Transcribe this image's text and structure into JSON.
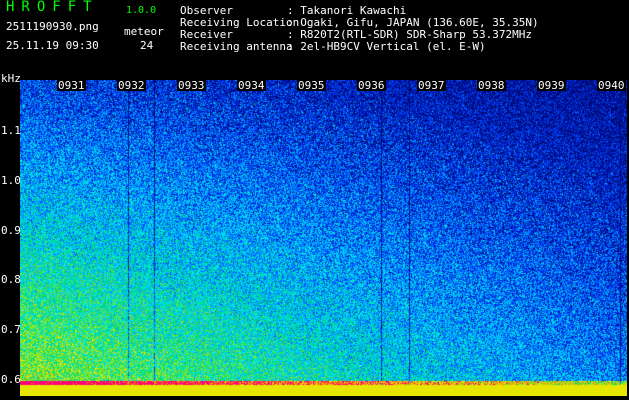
{
  "app": {
    "title": "HROFFT",
    "version": "1.0.0"
  },
  "file_name": "2511190930.png",
  "date_time": "25.11.19 09:30",
  "meteor": {
    "label": "meteor",
    "count": "24"
  },
  "info": [
    {
      "key": "Observer",
      "value": ": Takanori Kawachi"
    },
    {
      "key": "Receiving Location",
      "value": ": Ogaki, Gifu, JAPAN (136.60E, 35.35N)"
    },
    {
      "key": "Receiver",
      "value": ": R820T2(RTL-SDR) SDR-Sharp 53.372MHz"
    },
    {
      "key": "Receiving antenna",
      "value": ": 2el-HB9CV Vertical (el. E-W)"
    }
  ],
  "spectrogram": {
    "y_unit": "kHz",
    "y_ticks": [
      "1.1",
      "1.0",
      "0.9",
      "0.8",
      "0.7",
      "0.6"
    ],
    "x_ticks": [
      "0931",
      "0932",
      "0933",
      "0934",
      "0935",
      "0936",
      "0937",
      "0938",
      "0939",
      "0940"
    ],
    "colors": {
      "background": "#000000",
      "noise_low": "#0018c8",
      "noise_mid": "#00c8ff",
      "signal": "#ffff00",
      "peak": "#ff0080",
      "label": "#00ff00"
    }
  }
}
